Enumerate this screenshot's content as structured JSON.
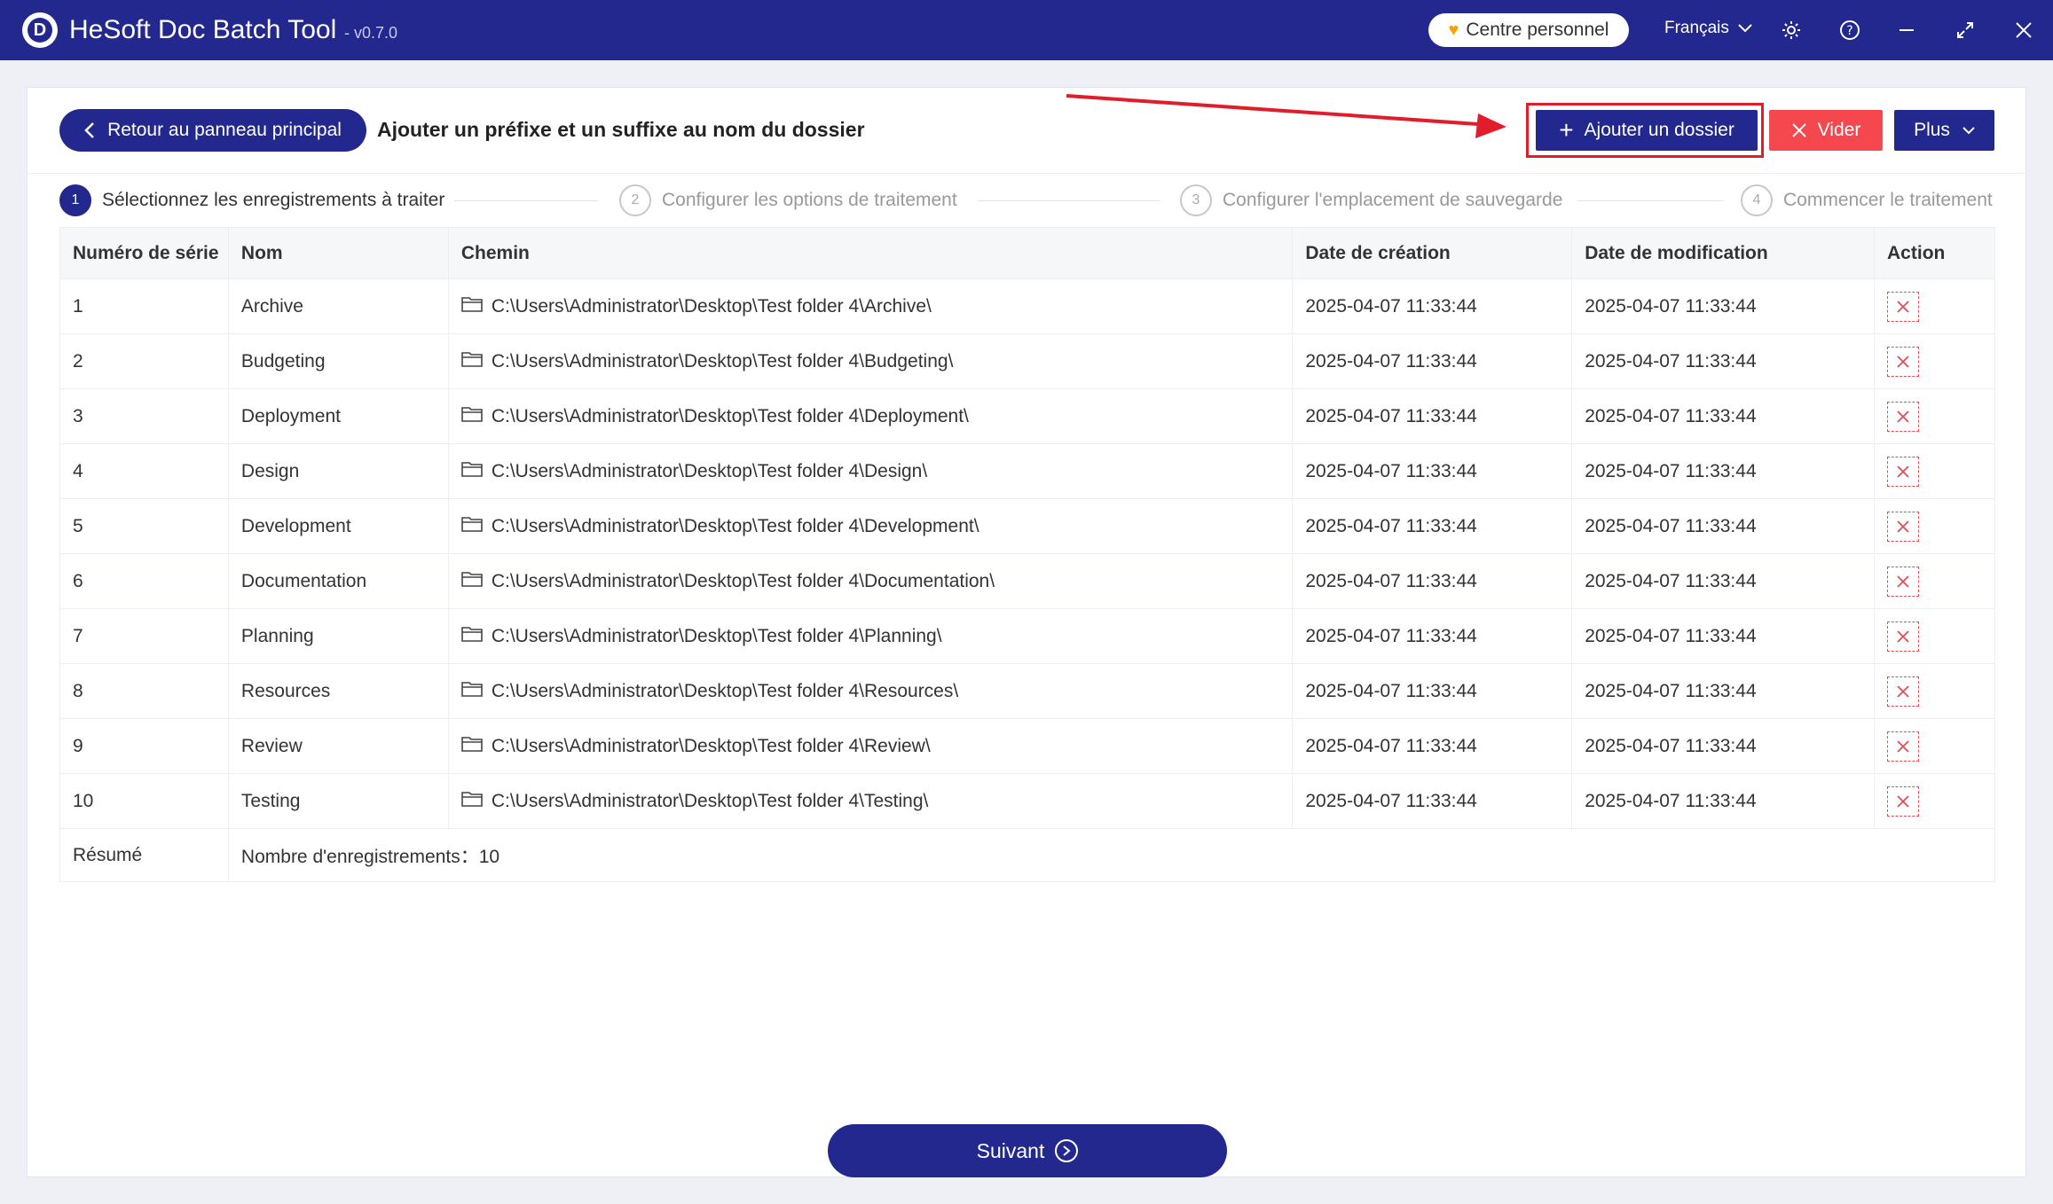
{
  "titlebar": {
    "logo_letter": "D",
    "app_name": "HeSoft Doc Batch Tool",
    "version": "- v0.7.0",
    "personal_center": "Centre personnel",
    "language": "Français"
  },
  "header": {
    "back_label": "Retour au panneau principal",
    "page_title": "Ajouter un préfixe et un suffixe au nom du dossier",
    "add_folder_label": "Ajouter un dossier",
    "clear_label": "Vider",
    "more_label": "Plus"
  },
  "steps": [
    {
      "num": "1",
      "label": "Sélectionnez les enregistrements à traiter"
    },
    {
      "num": "2",
      "label": "Configurer les options de traitement"
    },
    {
      "num": "3",
      "label": "Configurer l'emplacement de sauvegarde"
    },
    {
      "num": "4",
      "label": "Commencer le traitement"
    }
  ],
  "table": {
    "headers": [
      "Numéro de série",
      "Nom",
      "Chemin",
      "Date de création",
      "Date de modification",
      "Action"
    ],
    "rows": [
      {
        "n": "1",
        "name": "Archive",
        "path": "C:\\Users\\Administrator\\Desktop\\Test folder 4\\Archive\\",
        "created": "2025-04-07 11:33:44",
        "modified": "2025-04-07 11:33:44"
      },
      {
        "n": "2",
        "name": "Budgeting",
        "path": "C:\\Users\\Administrator\\Desktop\\Test folder 4\\Budgeting\\",
        "created": "2025-04-07 11:33:44",
        "modified": "2025-04-07 11:33:44"
      },
      {
        "n": "3",
        "name": "Deployment",
        "path": "C:\\Users\\Administrator\\Desktop\\Test folder 4\\Deployment\\",
        "created": "2025-04-07 11:33:44",
        "modified": "2025-04-07 11:33:44"
      },
      {
        "n": "4",
        "name": "Design",
        "path": "C:\\Users\\Administrator\\Desktop\\Test folder 4\\Design\\",
        "created": "2025-04-07 11:33:44",
        "modified": "2025-04-07 11:33:44"
      },
      {
        "n": "5",
        "name": "Development",
        "path": "C:\\Users\\Administrator\\Desktop\\Test folder 4\\Development\\",
        "created": "2025-04-07 11:33:44",
        "modified": "2025-04-07 11:33:44"
      },
      {
        "n": "6",
        "name": "Documentation",
        "path": "C:\\Users\\Administrator\\Desktop\\Test folder 4\\Documentation\\",
        "created": "2025-04-07 11:33:44",
        "modified": "2025-04-07 11:33:44"
      },
      {
        "n": "7",
        "name": "Planning",
        "path": "C:\\Users\\Administrator\\Desktop\\Test folder 4\\Planning\\",
        "created": "2025-04-07 11:33:44",
        "modified": "2025-04-07 11:33:44"
      },
      {
        "n": "8",
        "name": "Resources",
        "path": "C:\\Users\\Administrator\\Desktop\\Test folder 4\\Resources\\",
        "created": "2025-04-07 11:33:44",
        "modified": "2025-04-07 11:33:44"
      },
      {
        "n": "9",
        "name": "Review",
        "path": "C:\\Users\\Administrator\\Desktop\\Test folder 4\\Review\\",
        "created": "2025-04-07 11:33:44",
        "modified": "2025-04-07 11:33:44"
      },
      {
        "n": "10",
        "name": "Testing",
        "path": "C:\\Users\\Administrator\\Desktop\\Test folder 4\\Testing\\",
        "created": "2025-04-07 11:33:44",
        "modified": "2025-04-07 11:33:44"
      }
    ],
    "summary_label": "Résumé",
    "summary_text": "Nombre d'enregistrements：10"
  },
  "footer": {
    "next_label": "Suivant"
  },
  "colors": {
    "primary": "#23288f",
    "danger": "#f5474e",
    "highlight": "#e11d2b"
  }
}
